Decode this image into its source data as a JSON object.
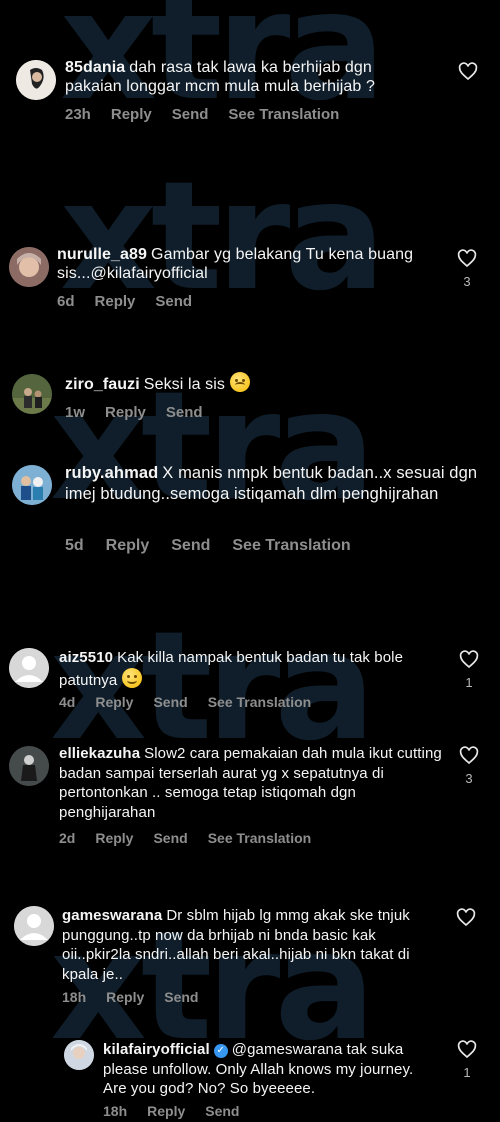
{
  "watermark": {
    "brand": "xtra"
  },
  "comments": [
    {
      "username": "85dania",
      "text": "dah rasa tak lawa ka berhijab dgn pakaian longgar mcm mula mula berhijab ?",
      "time": "23h",
      "actions": [
        "Reply",
        "Send",
        "See Translation"
      ],
      "likes": ""
    },
    {
      "username": "nurulle_a89",
      "text": "Gambar yg belakang Tu kena buang sis...@kilafairyofficial",
      "time": "6d",
      "actions": [
        "Reply",
        "Send"
      ],
      "likes": "3"
    },
    {
      "username": "ziro_fauzi",
      "text": "Seksi la sis",
      "time": "1w",
      "actions": [
        "Reply",
        "Send"
      ],
      "likes": ""
    },
    {
      "username": "ruby.ahmad",
      "text": "X manis nmpk bentuk badan..x sesuai dgn imej btudung..semoga istiqamah dlm penghijrahan",
      "time": "5d",
      "actions": [
        "Reply",
        "Send",
        "See Translation"
      ],
      "likes": ""
    },
    {
      "username": "aiz5510",
      "text": "Kak killa nampak bentuk badan tu tak bole patutnya",
      "time": "4d",
      "actions": [
        "Reply",
        "Send",
        "See Translation"
      ],
      "likes": "1"
    },
    {
      "username": "elliekazuha",
      "text": "Slow2 cara pemakaian dah mula ikut cutting badan sampai terserlah aurat yg x sepatutnya di pertontonkan .. semoga tetap istiqomah dgn penghijarahan",
      "time": "2d",
      "actions": [
        "Reply",
        "Send",
        "See Translation"
      ],
      "likes": "3"
    },
    {
      "username": "gameswarana",
      "text": "Dr sblm hijab lg mmg akak ske tnjuk punggung..tp now da brhijab ni bnda basic kak oii..pkir2la sndri..allah beri akal..hijab ni bkn takat di kpala je..",
      "time": "18h",
      "actions": [
        "Reply",
        "Send"
      ],
      "likes": ""
    },
    {
      "username": "kilafairyofficial",
      "text": "@gameswarana tak suka please unfollow. Only Allah knows my journey. Are you god? No? So byeeeee.",
      "time": "18h",
      "actions": [
        "Reply",
        "Send"
      ],
      "likes": "1"
    }
  ]
}
